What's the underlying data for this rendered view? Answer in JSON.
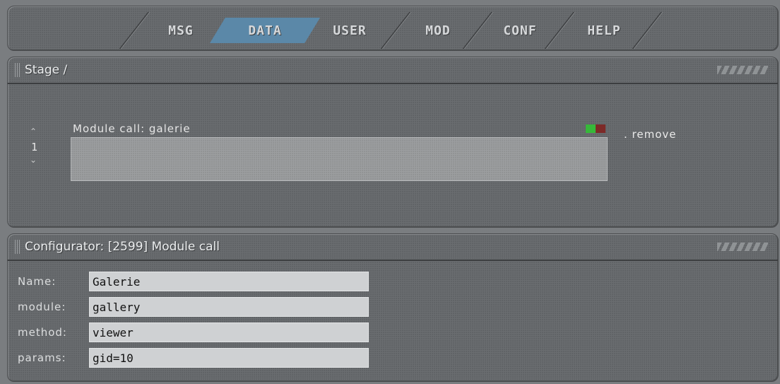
{
  "nav": {
    "tabs": [
      {
        "label": "MSG",
        "active": false
      },
      {
        "label": "DATA",
        "active": true
      },
      {
        "label": "USER",
        "active": false
      },
      {
        "label": "MOD",
        "active": false
      },
      {
        "label": "CONF",
        "active": false
      },
      {
        "label": "HELP",
        "active": false
      }
    ]
  },
  "stage": {
    "title": "Stage /",
    "item": {
      "index": "1",
      "label": "Module call: galerie",
      "remove_label": ". remove",
      "status_colors": [
        "#37b83a",
        "#7d2a28"
      ]
    }
  },
  "configurator": {
    "title": "Configurator: [2599] Module call",
    "fields": [
      {
        "label": "Name:",
        "value": "Galerie"
      },
      {
        "label": "module:",
        "value": "gallery"
      },
      {
        "label": "method:",
        "value": "viewer"
      },
      {
        "label": "params:",
        "value": "gid=10"
      }
    ]
  },
  "colors": {
    "active_tab": "#5b88a8",
    "panel": "#6a6d70"
  }
}
